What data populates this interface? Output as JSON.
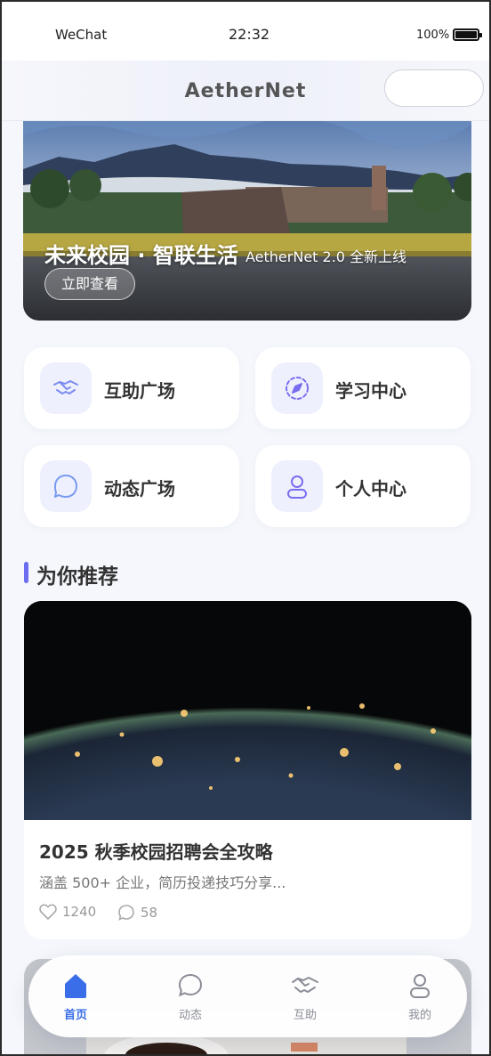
{
  "status_bar": {
    "carrier": "WeChat",
    "time": "22:32",
    "battery": "100%"
  },
  "nav": {
    "title": "AetherNet"
  },
  "banner": {
    "headline": "未来校园 · 智联生活",
    "subline": "AetherNet 2.0 全新上线",
    "cta": "立即查看"
  },
  "grid": [
    {
      "label": "互助广场",
      "icon": "handshake-icon"
    },
    {
      "label": "学习中心",
      "icon": "compass-icon"
    },
    {
      "label": "动态广场",
      "icon": "chat-bubble-icon"
    },
    {
      "label": "个人中心",
      "icon": "user-icon"
    }
  ],
  "section": {
    "title": "为你推荐"
  },
  "card": {
    "title": "2025 秋季校园招聘会全攻略",
    "desc": "涵盖 500+ 企业，简历投递技巧分享...",
    "likes": "1240",
    "comments": "58"
  },
  "tabs": [
    {
      "label": "首页",
      "icon": "home-icon",
      "active": true
    },
    {
      "label": "动态",
      "icon": "chat-bubble-icon",
      "active": false
    },
    {
      "label": "互助",
      "icon": "handshake-icon",
      "active": false
    },
    {
      "label": "我的",
      "icon": "user-icon",
      "active": false
    }
  ],
  "colors": {
    "accent": "#3a6ee8",
    "section_bar": "#6b6df0",
    "icon_bg": "#eef1fd",
    "icon_stroke": "#7a8bf0"
  }
}
